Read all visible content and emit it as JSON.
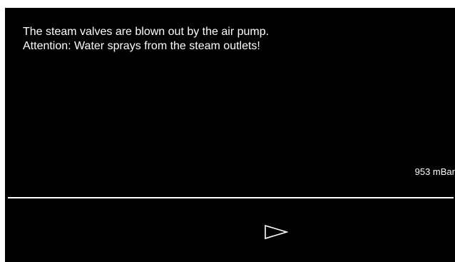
{
  "message": {
    "line1": "The steam valves are blown out by the air pump.",
    "line2": "Attention: Water sprays from the steam outlets!"
  },
  "status": {
    "pressure": "953 mBar"
  },
  "controls": {
    "next_icon": "triangle-right-outline-icon"
  },
  "colors": {
    "background": "#000000",
    "text": "#ffffff",
    "divider": "#ffffff"
  }
}
